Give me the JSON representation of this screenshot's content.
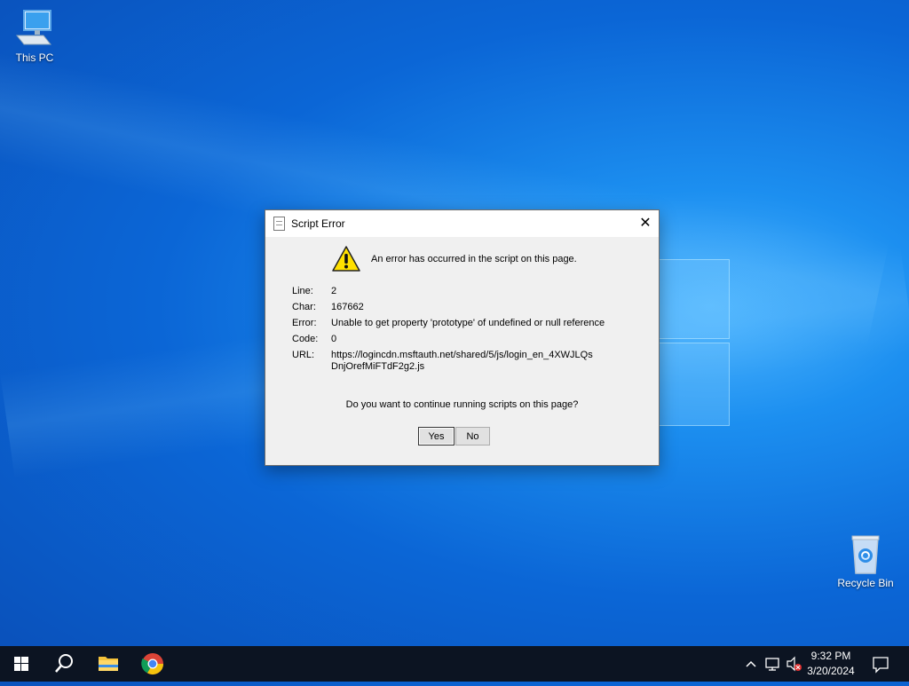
{
  "desktop": {
    "icons": [
      {
        "label": "This PC"
      },
      {
        "label": "Recycle Bin"
      }
    ]
  },
  "dialog": {
    "title": "Script Error",
    "close_glyph": "✕",
    "message": "An error has occurred in the script on this page.",
    "fields": [
      {
        "label": "Line:",
        "value": "2"
      },
      {
        "label": "Char:",
        "value": "167662"
      },
      {
        "label": "Error:",
        "value": "Unable to get property 'prototype' of undefined or null reference"
      },
      {
        "label": "Code:",
        "value": "0"
      },
      {
        "label": "URL:",
        "value": "https://logincdn.msftauth.net/shared/5/js/login_en_4XWJLQsDnjOrefMiFTdF2g2.js"
      }
    ],
    "question": "Do you want to continue running scripts on this page?",
    "buttons": {
      "yes": "Yes",
      "no": "No"
    }
  },
  "taskbar": {
    "time": "9:32 PM",
    "date": "3/20/2024",
    "pinned": [
      "windows-start-icon",
      "search-icon",
      "file-explorer-icon",
      "chrome-icon"
    ],
    "tray_icons": [
      "chevron-up-icon",
      "network-icon",
      "volume-muted-icon",
      "notifications-icon"
    ]
  },
  "colors": {
    "accent": "#0a66d6",
    "taskbar": "#0c1422",
    "warning": "#ffe000"
  }
}
